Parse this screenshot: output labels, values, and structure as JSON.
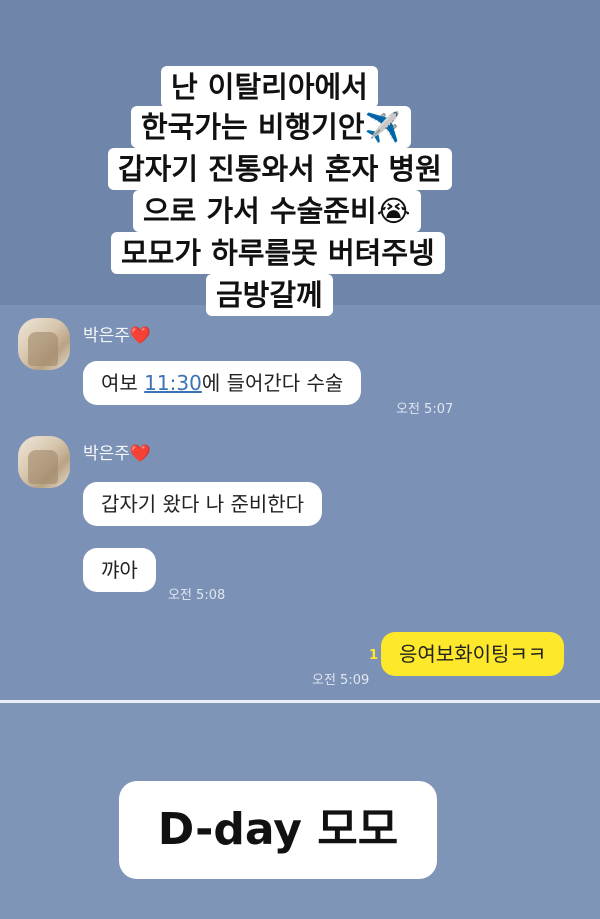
{
  "caption": {
    "lines": [
      "난 이탈리아에서",
      "한국가는 비행기안✈️",
      "갑자기 진통와서 혼자 병원",
      "으로 가서 수술준비😭",
      "모모가 하루를못 버텨주넹",
      "금방갈께"
    ]
  },
  "chat": {
    "sender_name": "박은주",
    "sender_emoji": "❤️",
    "msg1": {
      "before": "여보 ",
      "link": "11:30",
      "after": "에 들어간다 수술"
    },
    "time1": "오전 5:07",
    "msg2": "갑자기 왔다 나 준비한다",
    "msg3": "꺄아",
    "time2": "오전 5:08",
    "msg4": "응여보화이팅ㅋㅋ",
    "read_count": "1",
    "time3": "오전 5:09"
  },
  "footer": {
    "label": "D-day 모모"
  },
  "colors": {
    "chat_bg": "#7b91b5",
    "my_bubble": "#fde82b",
    "their_bubble": "#ffffff"
  }
}
